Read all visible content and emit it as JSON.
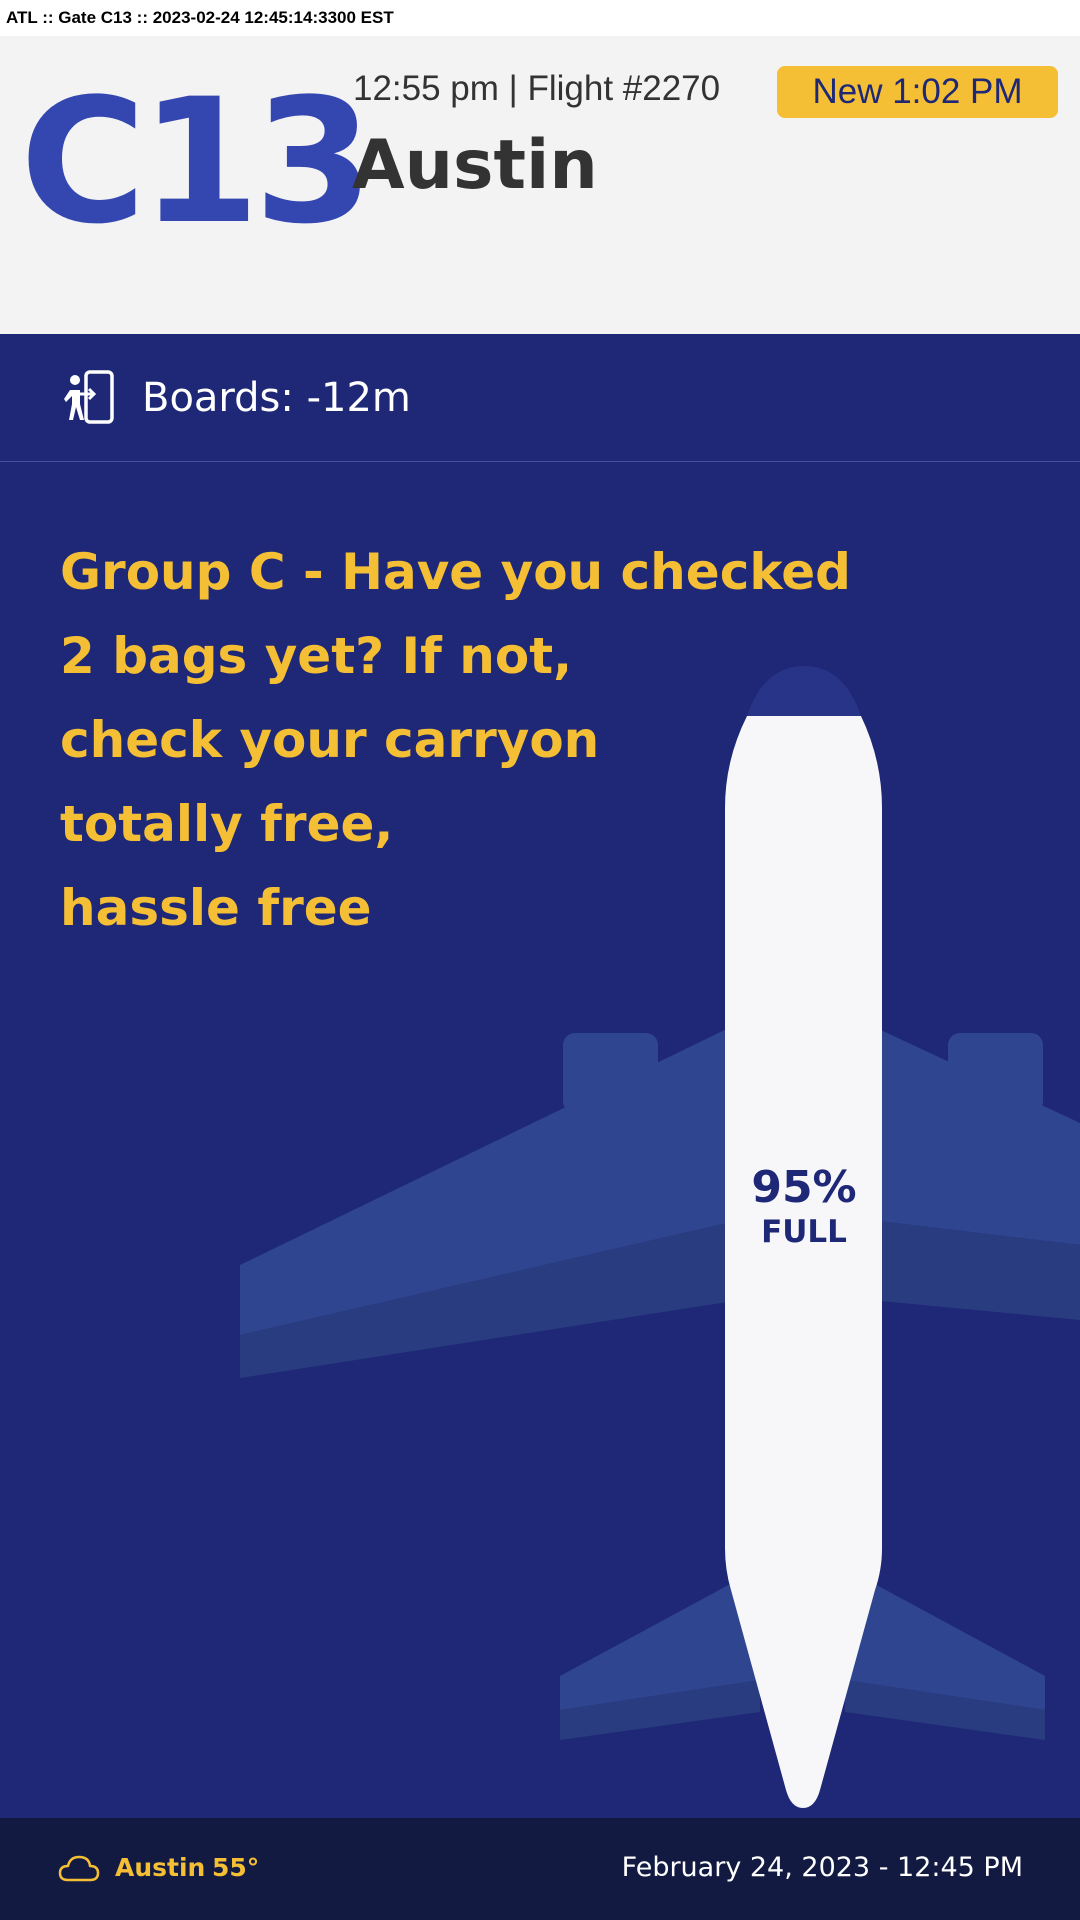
{
  "status_line": "ATL :: Gate C13 :: 2023-02-24 12:45:14:3300 EST",
  "gate": "C13",
  "time_flight": "12:55 pm | Flight #2270",
  "new_time": "New 1:02 PM",
  "destination": "Austin",
  "boards": {
    "label": "Boards: -12m",
    "icon": "boarding-door-icon"
  },
  "message": "Group C - Have you checked\n2 bags yet?  If not,\ncheck your carryon\ntotally free,\nhassle free",
  "capacity": {
    "percent_text": "95%",
    "label": "FULL",
    "value": 0.95
  },
  "footer": {
    "weather_icon": "cloud-icon",
    "city": "Austin",
    "temp": "55°",
    "datetime": "February 24, 2023 - 12:45 PM"
  },
  "colors": {
    "gate_blue": "#3447b0",
    "header_bg": "#f3f3f3",
    "dark_text": "#333333",
    "accent_yellow": "#f5bf35",
    "main_bg": "#1e2876",
    "wing_blue": "#2f4590",
    "fuselage": "#f7f7f9",
    "footer_bg": "#121a42"
  }
}
